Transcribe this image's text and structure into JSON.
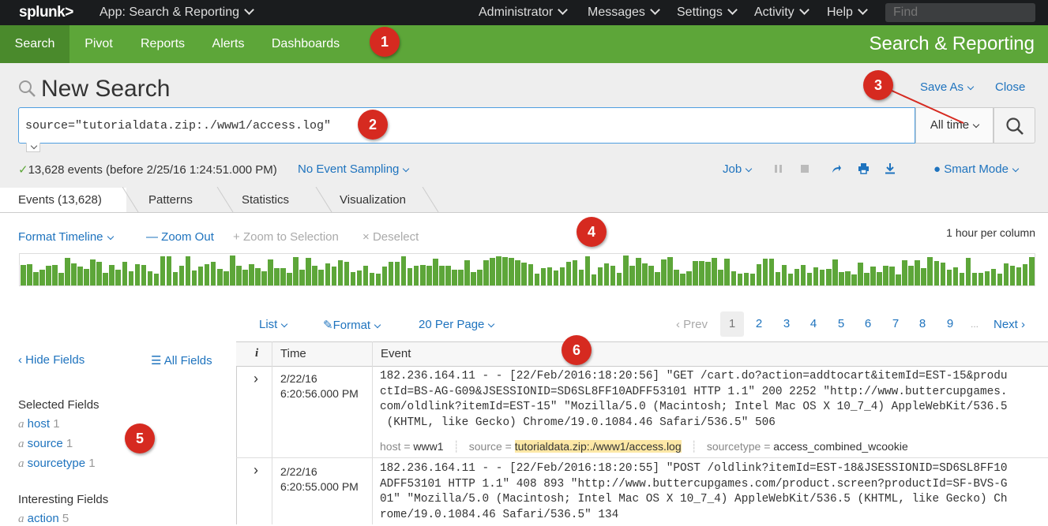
{
  "topbar": {
    "logo": "splunk>",
    "app": "App: Search & Reporting",
    "nav": [
      "Administrator",
      "Messages",
      "Settings",
      "Activity",
      "Help"
    ],
    "find_placeholder": "Find"
  },
  "appbar": {
    "tabs": [
      "Search",
      "Pivot",
      "Reports",
      "Alerts",
      "Dashboards"
    ],
    "title": "Search & Reporting"
  },
  "search": {
    "title": "New Search",
    "save_as": "Save As",
    "close": "Close",
    "query": "source=\"tutorialdata.zip:./www1/access.log\"",
    "time_range": "All time"
  },
  "status": {
    "events": "13,628 events (before 2/25/16 1:24:51.000 PM)",
    "sampling": "No Event Sampling",
    "job": "Job",
    "mode": "Smart Mode"
  },
  "tabs": [
    "Events (13,628)",
    "Patterns",
    "Statistics",
    "Visualization"
  ],
  "timeline": {
    "format": "Format Timeline",
    "zoom_out": "Zoom Out",
    "zoom_sel": "Zoom to Selection",
    "deselect": "Deselect",
    "scale": "1 hour per column",
    "bar_color": "#5da639"
  },
  "results": {
    "list": "List",
    "format": "Format",
    "per_page": "20 Per Page",
    "prev": "Prev",
    "pages": [
      "1",
      "2",
      "3",
      "4",
      "5",
      "6",
      "7",
      "8",
      "9"
    ],
    "ellipsis": "...",
    "next": "Next"
  },
  "sidebar": {
    "hide": "Hide Fields",
    "all": "All Fields",
    "selected_heading": "Selected Fields",
    "selected": [
      {
        "type": "a",
        "name": "host",
        "count": "1"
      },
      {
        "type": "a",
        "name": "source",
        "count": "1"
      },
      {
        "type": "a",
        "name": "sourcetype",
        "count": "1"
      }
    ],
    "interesting_heading": "Interesting Fields",
    "interesting": [
      {
        "type": "a",
        "name": "action",
        "count": "5"
      }
    ]
  },
  "table": {
    "col_i": "i",
    "col_time": "Time",
    "col_event": "Event",
    "rows": [
      {
        "date": "2/22/16",
        "time": "6:20:56.000 PM",
        "lines": [
          "182.236.164.11 - - [22/Feb/2016:18:20:56] \"GET /cart.do?action=addtocart&itemId=EST-15&produ",
          "ctId=BS-AG-G09&JSESSIONID=SD6SL8FF10ADFF53101 HTTP 1.1\" 200 2252 \"http://www.buttercupgames.",
          "com/oldlink?itemId=EST-15\" \"Mozilla/5.0 (Macintosh; Intel Mac OS X 10_7_4) AppleWebKit/536.5",
          " (KHTML, like Gecko) Chrome/19.0.1084.46 Safari/536.5\" 506"
        ],
        "fields": {
          "host_label": "host =",
          "host": "www1",
          "source_label": "source =",
          "source": "tutorialdata.zip:./www1/access.log",
          "sourcetype_label": "sourcetype =",
          "sourcetype": "access_combined_wcookie"
        }
      },
      {
        "date": "2/22/16",
        "time": "6:20:55.000 PM",
        "lines": [
          "182.236.164.11 - - [22/Feb/2016:18:20:55] \"POST /oldlink?itemId=EST-18&JSESSIONID=SD6SL8FF10",
          "ADFF53101 HTTP 1.1\" 408 893 \"http://www.buttercupgames.com/product.screen?productId=SF-BVS-G",
          "01\" \"Mozilla/5.0 (Macintosh; Intel Mac OS X 10_7_4) AppleWebKit/536.5 (KHTML, like Gecko) Ch",
          "rome/19.0.1084.46 Safari/536.5\" 134"
        ]
      }
    ]
  },
  "callouts": [
    "1",
    "2",
    "3",
    "4",
    "5",
    "6"
  ],
  "colors": {
    "accent": "#5da639",
    "link": "#1e73be",
    "callout": "#d62a20"
  }
}
